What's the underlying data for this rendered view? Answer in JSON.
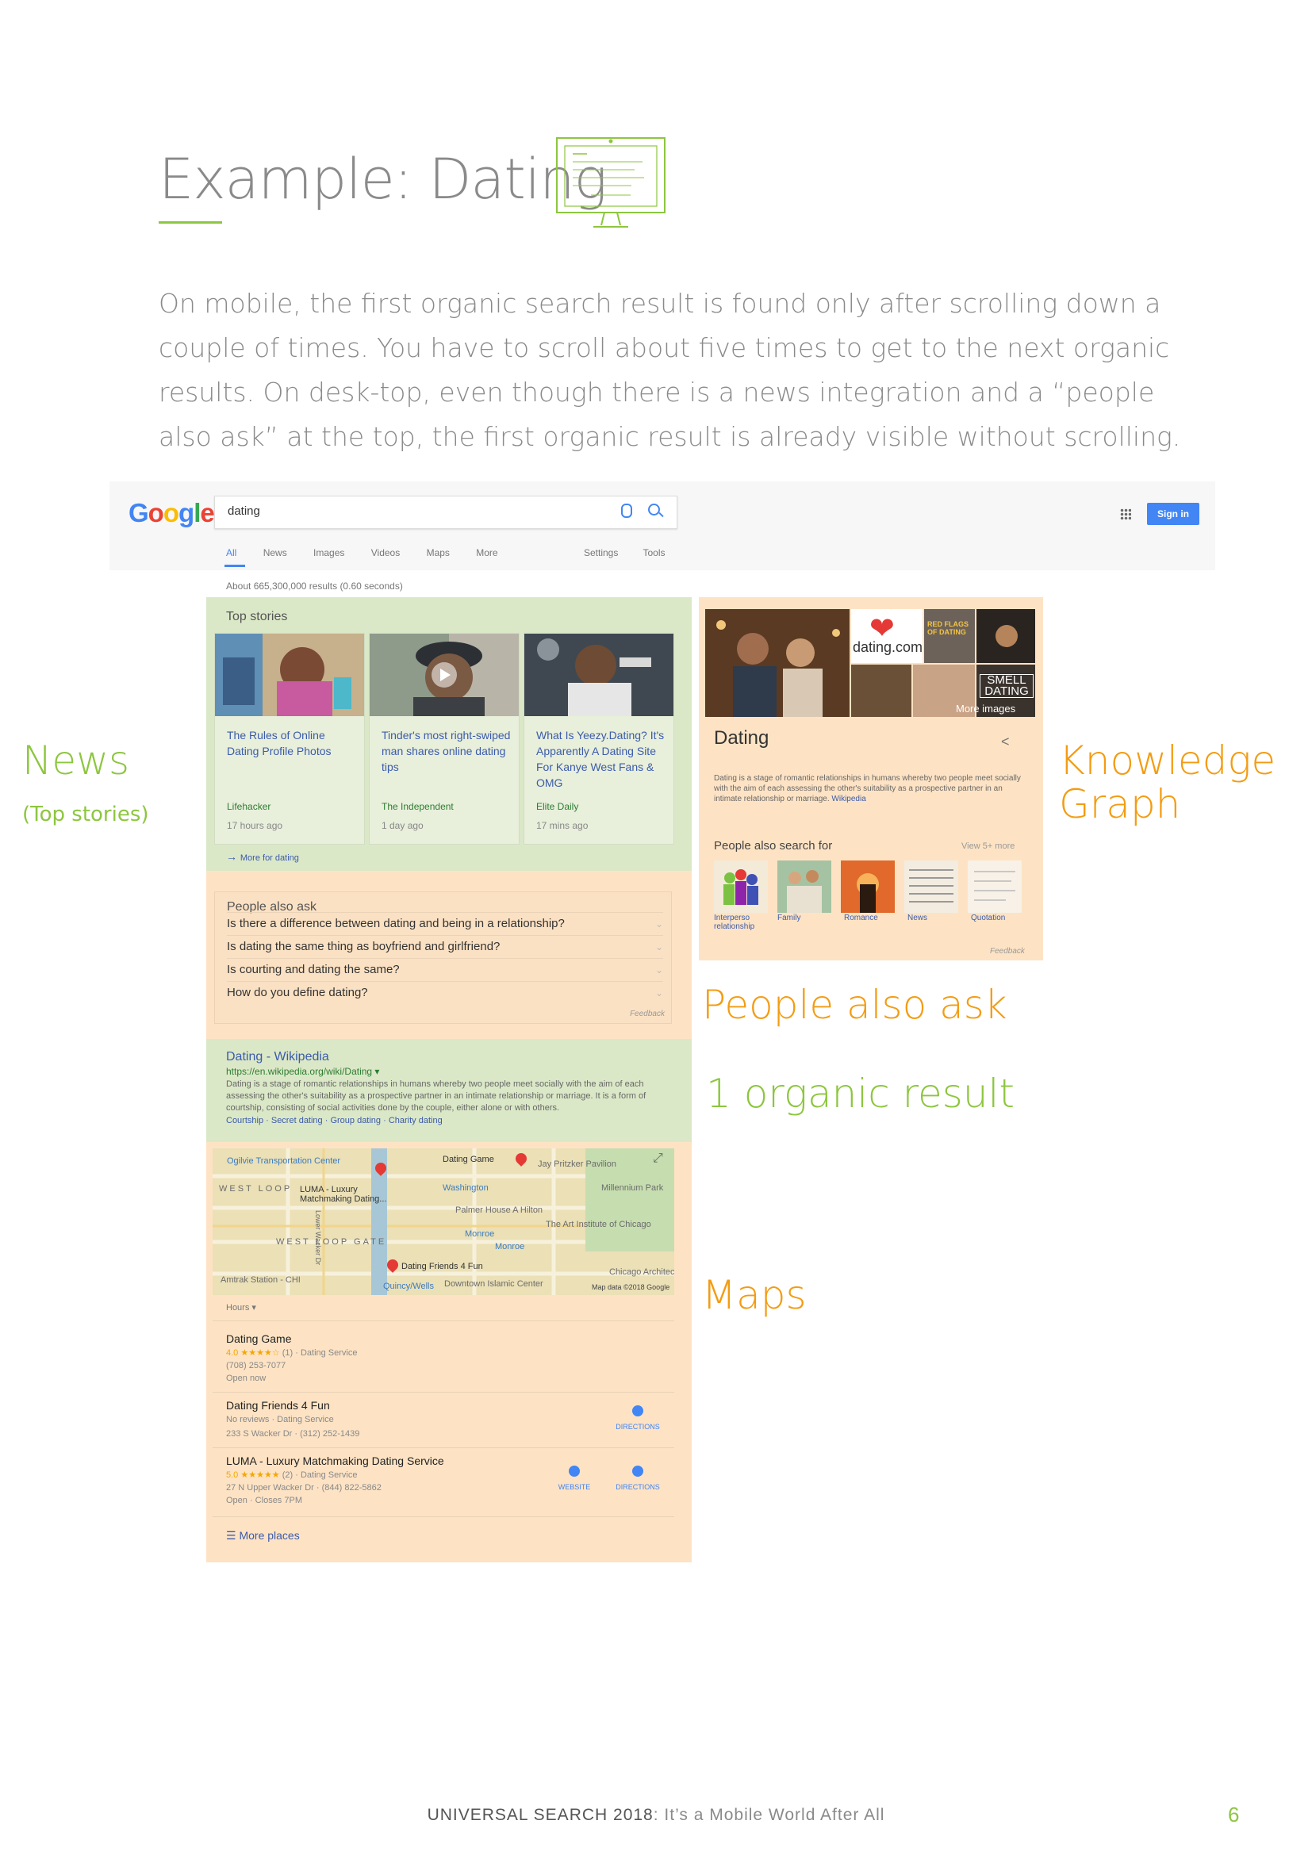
{
  "page": {
    "title": "Example: Dating",
    "intro": "On mobile, the first organic search result is found only after scrolling down a couple of times. You have to scroll about five times to get to the next organic results. On desk-top, even though there is a news integration and a “people also ask” at the top, the first organic result is already visible without scrolling.",
    "footer_bold": "UNIVERSAL SEARCH 2018",
    "footer_rest": ": It’s a Mobile World After All",
    "page_number": "6",
    "accent_green": "#8dc63f",
    "accent_orange": "#f39c12"
  },
  "annotations": {
    "news": "News",
    "news_sub": "(Top stories)",
    "knowledge_graph_1": "Knowledge",
    "knowledge_graph_2": "Graph",
    "people_also_ask": "People also ask",
    "organic": "1 organic result",
    "maps": "Maps"
  },
  "serp": {
    "logo": [
      "G",
      "o",
      "o",
      "g",
      "l",
      "e"
    ],
    "query": "dating",
    "sign_in": "Sign in",
    "tabs": [
      "All",
      "News",
      "Images",
      "Videos",
      "Maps",
      "More"
    ],
    "tabs_right": [
      "Settings",
      "Tools"
    ],
    "result_stats": "About 665,300,000 results (0.60 seconds)",
    "top_stories": {
      "heading": "Top stories",
      "cards": [
        {
          "headline": "The Rules of Online Dating Profile Photos",
          "source": "Lifehacker",
          "age": "17 hours ago"
        },
        {
          "headline": "Tinder's most right-swiped man shares online dating tips",
          "source": "The Independent",
          "age": "1 day ago"
        },
        {
          "headline": "What Is Yeezy.Dating? It's Apparently A Dating Site For Kanye West Fans & OMG",
          "source": "Elite Daily",
          "age": "17 mins ago"
        }
      ],
      "more": "More for dating"
    },
    "people_also_ask": {
      "heading": "People also ask",
      "questions": [
        "Is there a difference between dating and being in a relationship?",
        "Is dating the same thing as boyfriend and girlfriend?",
        "Is courting and dating the same?",
        "How do you define dating?"
      ],
      "feedback": "Feedback"
    },
    "organic": {
      "title": "Dating - Wikipedia",
      "url": "https://en.wikipedia.org/wiki/Dating ▾",
      "snippet": "Dating is a stage of romantic relationships in humans whereby two people meet socially with the aim of each assessing the other's suitability as a prospective partner in an intimate relationship or marriage. It is a form of courtship, consisting of social activities done by the couple, either alone or with others.",
      "links": "Courtship · Secret dating · Group dating · Charity dating"
    },
    "map": {
      "labels": {
        "ogilvie": "Ogilvie Transportation Center",
        "west_loop": "WEST LOOP",
        "luma": "LUMA - Luxury Matchmaking Dating...",
        "dating_game": "Dating Game",
        "pritzker": "Jay Pritzker Pavilion",
        "washington": "Washington",
        "millennium": "Millennium Park",
        "palmer": "Palmer House A Hilton",
        "art_institute": "The Art Institute of Chicago",
        "monroe1": "Monroe",
        "monroe2": "Monroe",
        "west_loop_gate": "WEST LOOP GATE",
        "dating_friends": "Dating Friends 4 Fun",
        "arch_foundation": "Chicago Architecture Foundation",
        "amtrak": "Amtrak Station - CHI",
        "quincy": "Quincy/Wells",
        "islamic": "Downtown Islamic Center",
        "lower_wacker": "Lower Wacker Dr",
        "map_data": "Map data ©2018 Google"
      },
      "hours": "Hours ▾",
      "places": [
        {
          "name": "Dating Game",
          "rating": "4.0",
          "stars": "★★★★☆",
          "meta": "(1) · Dating Service",
          "line2": "(708) 253-7077",
          "line3": "Open now"
        },
        {
          "name": "Dating Friends 4 Fun",
          "meta": "No reviews · Dating Service",
          "line2": "233 S Wacker Dr · (312) 252-1439",
          "action1": "DIRECTIONS"
        },
        {
          "name": "LUMA - Luxury Matchmaking Dating Service",
          "rating": "5.0",
          "stars": "★★★★★",
          "meta": "(2) · Dating Service",
          "line2": "27 N Upper Wacker Dr · (844) 822-5862",
          "line3": "Open · Closes 7PM",
          "action1": "WEBSITE",
          "action2": "DIRECTIONS"
        }
      ],
      "more_places": "More places"
    },
    "knowledge_graph": {
      "brand": "dating.com",
      "red_flags": "RED FLAGS OF DATING",
      "smell": "SMELL DATING",
      "more_images": "More images",
      "title": "Dating",
      "description": "Dating is a stage of romantic relationships in humans whereby two people meet socially with the aim of each assessing the other's suitability as a prospective partner in an intimate relationship or marriage.",
      "source": "Wikipedia",
      "pas_heading": "People also search for",
      "view_more": "View 5+ more",
      "related": [
        "Interperso relationship",
        "Family",
        "Romance",
        "News",
        "Quotation"
      ],
      "feedback": "Feedback"
    }
  }
}
